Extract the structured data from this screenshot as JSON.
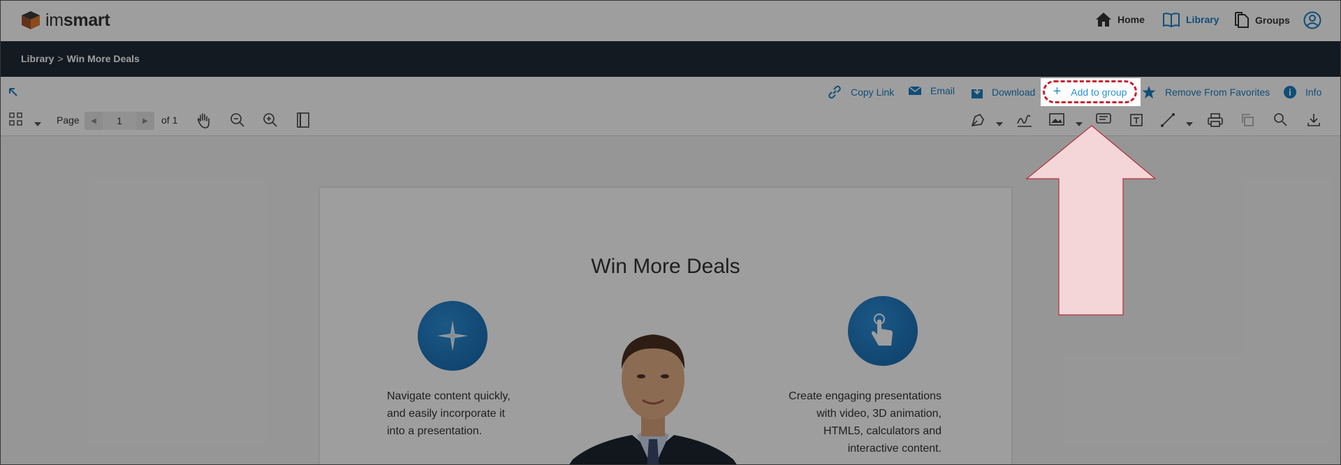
{
  "brand": {
    "name_light": "im",
    "name_bold": "smart"
  },
  "nav": {
    "home": "Home",
    "library": "Library",
    "groups": "Groups"
  },
  "breadcrumb": {
    "root": "Library",
    "separator": ">",
    "current": "Win More Deals"
  },
  "actions": {
    "copy_link": "Copy Link",
    "email": "Email",
    "download": "Download",
    "add_to_group": "Add to group",
    "remove_favorites": "Remove From Favorites",
    "info": "Info"
  },
  "toolbar": {
    "page_label": "Page",
    "page_value": "1",
    "page_total": "of 1"
  },
  "document": {
    "title": "Win More Deals",
    "left_text": [
      "Navigate content quickly,",
      "and easily incorporate it",
      "into a presentation."
    ],
    "right_text": [
      "Create engaging presentations",
      "with video, 3D animation,",
      "HTML5, calculators and",
      "interactive content."
    ]
  },
  "colors": {
    "accent": "#1a7fc1",
    "header_dark": "#1f2a36",
    "highlight_border": "#c82030",
    "arrow_fill": "#f4d6d8"
  }
}
